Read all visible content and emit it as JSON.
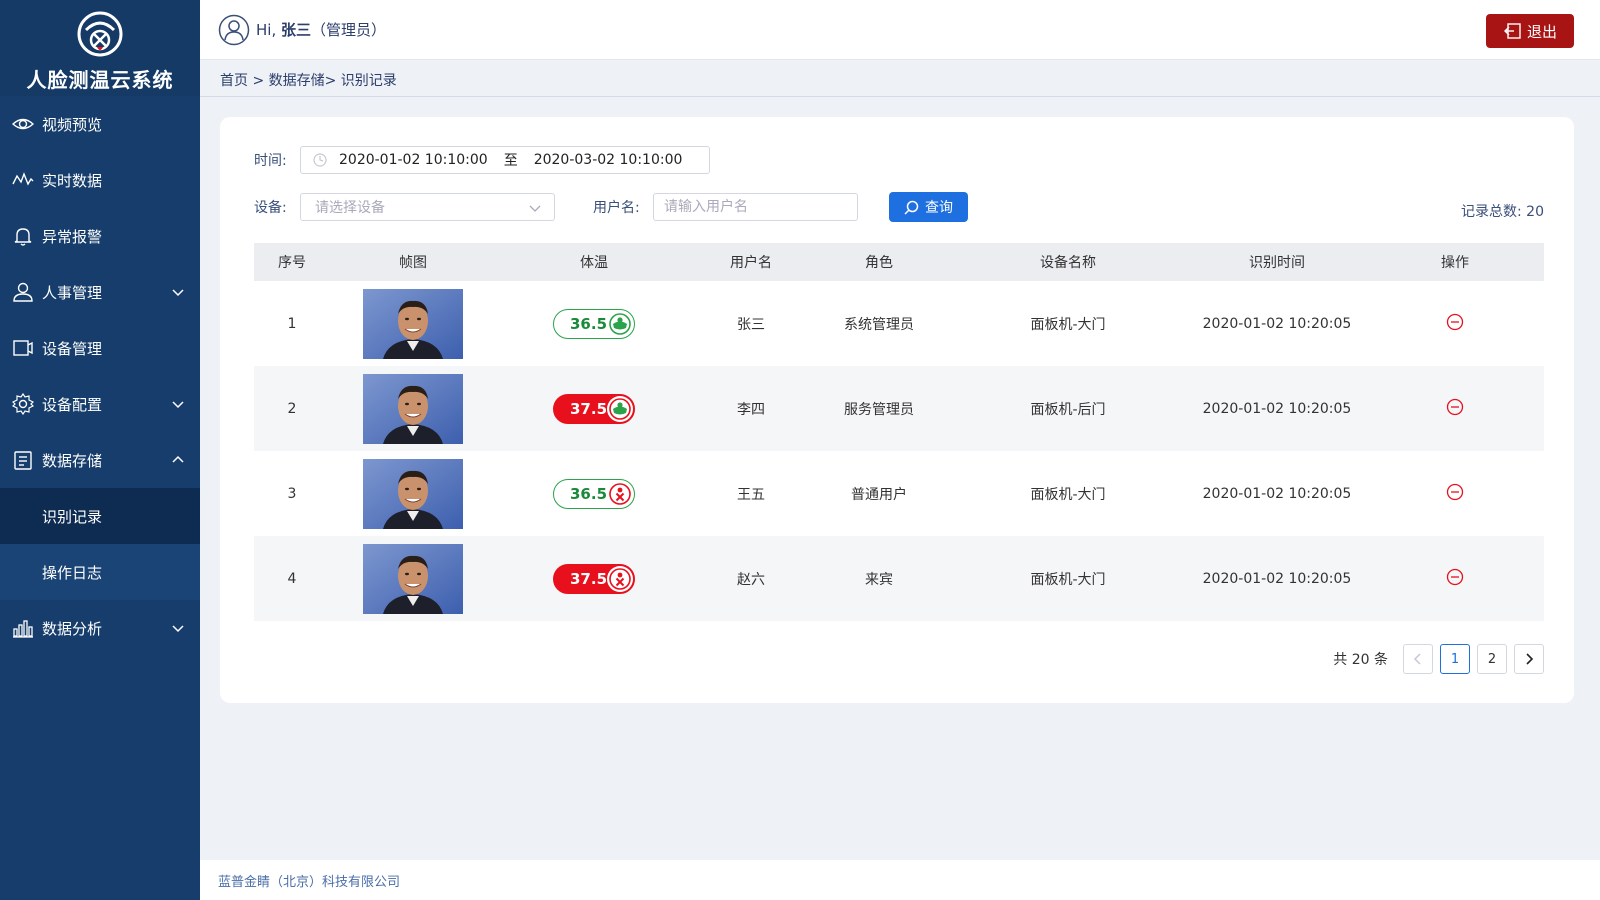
{
  "app": {
    "title": "人脸测温云系统"
  },
  "sidebar": {
    "items": [
      {
        "label": "视频预览",
        "icon": "eye-icon"
      },
      {
        "label": "实时数据",
        "icon": "activity-icon"
      },
      {
        "label": "异常报警",
        "icon": "bell-icon"
      },
      {
        "label": "人事管理",
        "icon": "user-icon"
      },
      {
        "label": "设备管理",
        "icon": "device-icon"
      },
      {
        "label": "设备配置",
        "icon": "gear-icon"
      },
      {
        "label": "数据存储",
        "icon": "storage-icon"
      },
      {
        "label": "数据分析",
        "icon": "bar-chart-icon"
      }
    ],
    "sub_items": [
      {
        "label": "识别记录",
        "active": true
      },
      {
        "label": "操作日志",
        "active": false
      }
    ]
  },
  "header": {
    "greeting_prefix": "Hi,",
    "user_name": "张三",
    "role": "（管理员）",
    "logout_label": "退出"
  },
  "breadcrumb": {
    "text": "首页 > 数据存储> 识别记录"
  },
  "filters": {
    "time_label": "时间:",
    "start_time": "2020-01-02  10:10:00",
    "range_sep": "至",
    "end_time": "2020-03-02  10:10:00",
    "device_label": "设备:",
    "device_placeholder": "请选择设备",
    "user_label": "用户名:",
    "user_placeholder": "请输入用户名",
    "search_label": "查询",
    "total_label": "记录总数:  20"
  },
  "table": {
    "columns": [
      "序号",
      "帧图",
      "体温",
      "用户名",
      "角色",
      "设备名称",
      "识别时间",
      "操作"
    ],
    "rows": [
      {
        "index": "1",
        "temp": "36.5",
        "temp_status": "normal",
        "mask": true,
        "user": "张三",
        "role": "系统管理员",
        "device": "面板机-大门",
        "time": "2020-01-02 10:20:05"
      },
      {
        "index": "2",
        "temp": "37.5",
        "temp_status": "high",
        "mask": true,
        "user": "李四",
        "role": "服务管理员",
        "device": "面板机-后门",
        "time": "2020-01-02 10:20:05"
      },
      {
        "index": "3",
        "temp": "36.5",
        "temp_status": "normal",
        "mask": false,
        "user": "王五",
        "role": "普通用户",
        "device": "面板机-大门",
        "time": "2020-01-02 10:20:05"
      },
      {
        "index": "4",
        "temp": "37.5",
        "temp_status": "high",
        "mask": false,
        "user": "赵六",
        "role": "来宾",
        "device": "面板机-大门",
        "time": "2020-01-02 10:20:05"
      }
    ]
  },
  "pagination": {
    "count_text": "共 20 条",
    "pages": [
      "1",
      "2"
    ],
    "current": "1"
  },
  "footer": {
    "text": "蓝普金睛（北京）科技有限公司"
  },
  "colors": {
    "sidebar": "#163d6b",
    "accent": "#1e6fe0",
    "danger": "#e8101c",
    "ok": "#2aa34a",
    "logout": "#a81414"
  }
}
